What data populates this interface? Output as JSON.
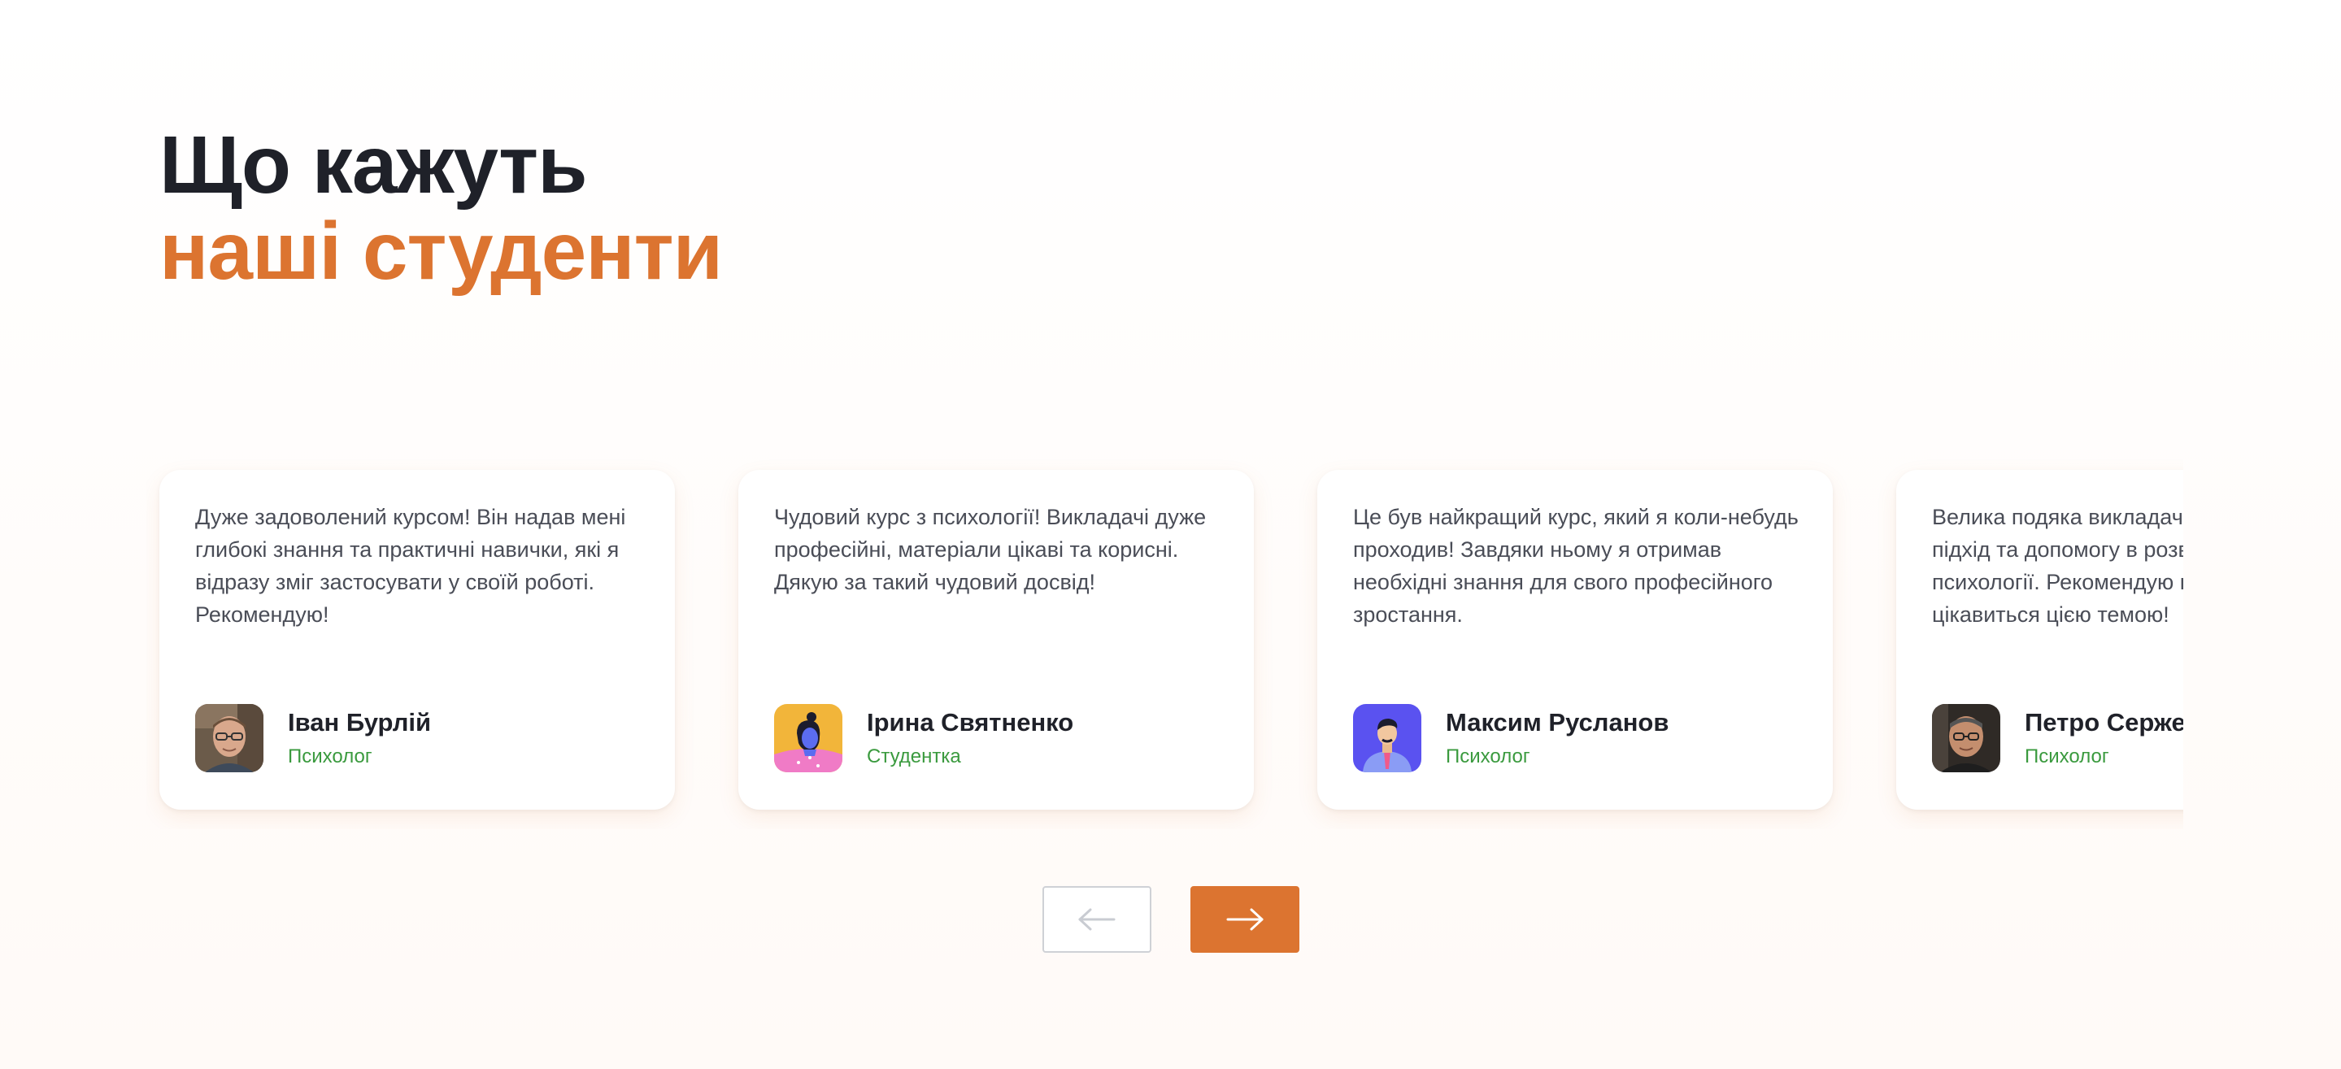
{
  "heading": {
    "line1": "Що кажуть",
    "line2": "наші студенти"
  },
  "colors": {
    "accent": "#dc7430",
    "heading": "#1f2129",
    "role": "#3a9a3e"
  },
  "testimonials": [
    {
      "quote": "Дуже задоволений курсом! Він надав мені глибокі знання та практичні навички, які я відразу зміг застосувати у своїй роботі. Рекомендую!",
      "name": "Іван Бурлій",
      "role": "Психолог",
      "avatar": "man-photo-glasses"
    },
    {
      "quote": "Чудовий курс з психології! Викладачі дуже професійні, матеріали цікаві та корисні. Дякую за такий чудовий досвід!",
      "name": "Ірина Святненко",
      "role": "Студентка",
      "avatar": "woman-illustration"
    },
    {
      "quote": "Це був найкращий курс, який я коли-небудь проходив! Завдяки ньому я отримав необхідні знання для свого професійного зростання.",
      "name": "Максим Русланов",
      "role": "Психолог",
      "avatar": "man-illustration"
    },
    {
      "quote": "Велика подяка викладачам за професійний підхід та допомогу в розвитку моєї кар'єри в психології. Рекомендую цей курс всім, хто цікавиться цією темою!",
      "name": "Петро Сержевич",
      "role": "Психолог",
      "avatar": "man-photo-older"
    }
  ],
  "controls": {
    "prev_icon": "arrow-left-icon",
    "next_icon": "arrow-right-icon"
  }
}
